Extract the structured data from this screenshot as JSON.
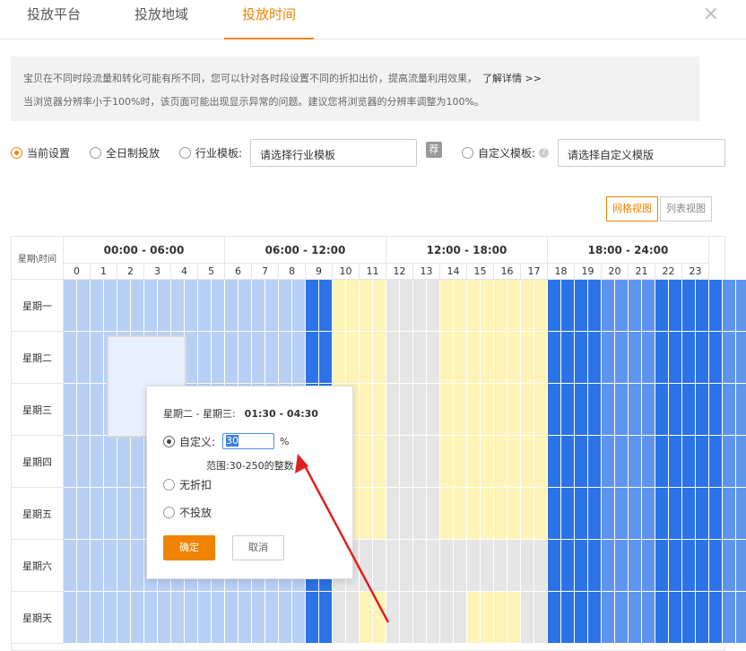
{
  "tabs": [
    {
      "label": "投放平台"
    },
    {
      "label": "投放地域"
    },
    {
      "label": "投放时间"
    }
  ],
  "close_label": "×",
  "notice": {
    "line1": "宝贝在不同时段流量和转化可能有所不同，您可以针对各时段设置不同的折扣出价，提高流量利用效果，",
    "more": "了解详情 >>",
    "line2": "当浏览器分辨率小于100%时，该页面可能出现显示异常的问题。建议您将浏览器的分辨率调整为100%。"
  },
  "options": {
    "current": "当前设置",
    "allday": "全日制投放",
    "industry": "行业模板:",
    "industry_placeholder": "请选择行业模板",
    "rec_badge": "荐",
    "custom": "自定义模板:",
    "help_icon": "?",
    "custom_placeholder": "请选择自定义模版"
  },
  "views": {
    "grid": "网格视图",
    "list": "列表视图"
  },
  "grid": {
    "corner": "星期\\时间",
    "groups": [
      "00:00 - 06:00",
      "06:00 - 12:00",
      "12:00 - 18:00",
      "18:00 - 24:00"
    ],
    "hours": [
      "0",
      "1",
      "2",
      "3",
      "4",
      "5",
      "6",
      "7",
      "8",
      "9",
      "10",
      "11",
      "12",
      "13",
      "14",
      "15",
      "16",
      "17",
      "18",
      "19",
      "20",
      "21",
      "22",
      "23"
    ],
    "days": [
      "星期一",
      "星期二",
      "星期三",
      "星期四",
      "星期五",
      "星期六",
      "星期天"
    ],
    "legend_colors": {
      "L": "#b8d0f6",
      "D": "#2b73e6",
      "M": "#5f94ee",
      "Y": "#fff4b8",
      "G": "#e5e5e5"
    },
    "rows": [
      "LLLLLLLLLLLLLLLLLLDDYYYYGGGGYYYYYYYYDDDDMMMMDDDDDMMM",
      "LLLLLLLLLLLLLLLLLLDDYYYYGGGGYYYYYYYYDDDDMMMMDDDDDMMM",
      "LLLLLLLLLLLLLLLLLLDDYYYYGGGGYYYYYYYYDDDDMMMMDDDDDMMM",
      "LLLLLLLLLLLLLLLLLLDDYYYYGGGGYYYYYYYYDDDDMMMMDDDDDMMM",
      "LLLLLLLLLLLLLLLLLLDDYYYYGGGGYYYYYYYYDDDDMMMMDDDDDMMM",
      "LLLLLLLLLLLLLLLLLLDDGGGGGGGGGGGGGGGGDDDDMMMMDDDDDMMM",
      "LLLLLLLLLLLLLLLLLLDDGGYYGGGGGGYYYYGGDDDDMMMMDDDDDMMM"
    ]
  },
  "popup": {
    "title": "星期二 - 星期三:",
    "time": "01:30 - 04:30",
    "custom_label": "自定义:",
    "value": "30",
    "unit": "%",
    "range": "范围:30-250的整数",
    "no_discount": "无折扣",
    "no_delivery": "不投放",
    "ok": "确定",
    "cancel": "取消"
  },
  "annotation_color": "#e02020"
}
